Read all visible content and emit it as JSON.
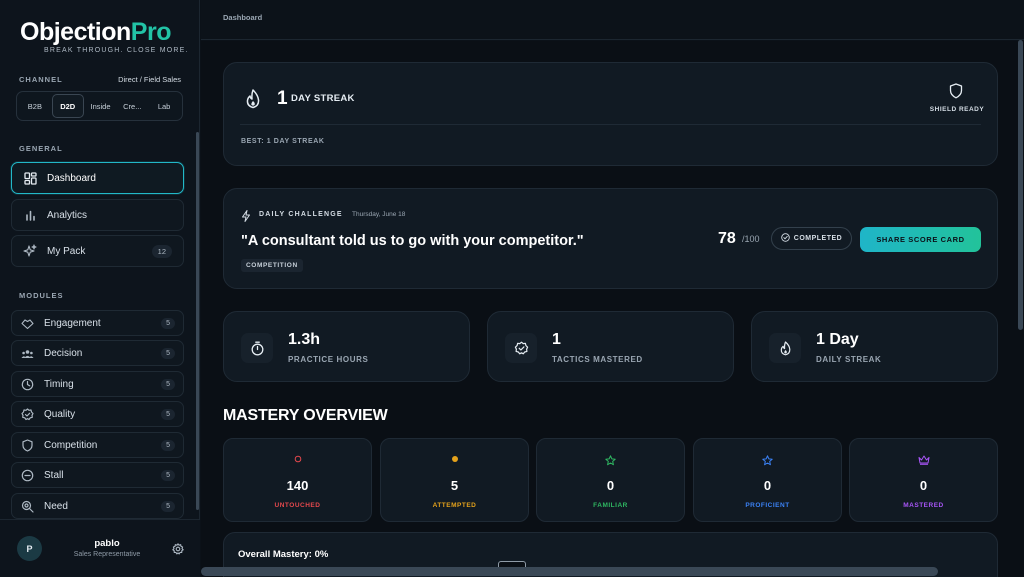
{
  "brand": {
    "logo_main": "Objection",
    "logo_accent": "Pro",
    "tagline": "BREAK THROUGH.  CLOSE MORE."
  },
  "channel": {
    "label": "CHANNEL",
    "value": "Direct / Field Sales",
    "options": [
      "B2B",
      "D2D",
      "Inside",
      "Cre...",
      "Lab"
    ],
    "selected": "D2D"
  },
  "general": {
    "label": "GENERAL",
    "items": [
      {
        "label": "Dashboard",
        "icon": "dashboard-icon",
        "active": true
      },
      {
        "label": "Analytics",
        "icon": "bar-chart-icon"
      },
      {
        "label": "My Pack",
        "icon": "sparkles-icon",
        "badge": "12"
      }
    ]
  },
  "modules": {
    "label": "MODULES",
    "items": [
      {
        "label": "Engagement",
        "icon": "handshake-icon",
        "badge": "5"
      },
      {
        "label": "Decision",
        "icon": "users-icon",
        "badge": "5"
      },
      {
        "label": "Timing",
        "icon": "clock-icon",
        "badge": "5"
      },
      {
        "label": "Quality",
        "icon": "badge-check-icon",
        "badge": "5"
      },
      {
        "label": "Competition",
        "icon": "shield-icon",
        "badge": "5"
      },
      {
        "label": "Stall",
        "icon": "minus-circle-icon",
        "badge": "5"
      },
      {
        "label": "Need",
        "icon": "search-icon",
        "badge": "5"
      }
    ]
  },
  "user": {
    "initial": "P",
    "name": "pablo",
    "role": "Sales Representative"
  },
  "breadcrumb": "Dashboard",
  "streak": {
    "count": "1",
    "label": "DAY STREAK",
    "shield_label": "SHIELD READY",
    "best": "BEST: 1 DAY STREAK"
  },
  "challenge": {
    "label": "DAILY CHALLENGE",
    "date": "Thursday, June 18",
    "quote": "\"A consultant told us to go with your competitor.\"",
    "tag": "COMPETITION",
    "score": "78",
    "score_max": "/100",
    "status": "COMPLETED",
    "share_label": "SHARE SCORE CARD"
  },
  "stats": [
    {
      "value": "1.3h",
      "label": "PRACTICE HOURS",
      "icon": "stopwatch-icon"
    },
    {
      "value": "1",
      "label": "TACTICS MASTERED",
      "icon": "badge-check-icon"
    },
    {
      "value": "1 Day",
      "label": "DAILY STREAK",
      "icon": "flame-icon"
    }
  ],
  "mastery": {
    "title": "MASTERY OVERVIEW",
    "levels": [
      {
        "value": "140",
        "label": "UNTOUCHED",
        "color": "#e5484d",
        "icon": "circle-outline-icon"
      },
      {
        "value": "5",
        "label": "ATTEMPTED",
        "color": "#e5a21b",
        "icon": "dot-icon"
      },
      {
        "value": "0",
        "label": "FAMILIAR",
        "color": "#2fb862",
        "icon": "star-outline-icon"
      },
      {
        "value": "0",
        "label": "PROFICIENT",
        "color": "#3b82f6",
        "icon": "star-outline-icon"
      },
      {
        "value": "0",
        "label": "MASTERED",
        "color": "#a855f7",
        "icon": "crown-icon"
      }
    ],
    "overall": "Overall Mastery: 0%"
  }
}
